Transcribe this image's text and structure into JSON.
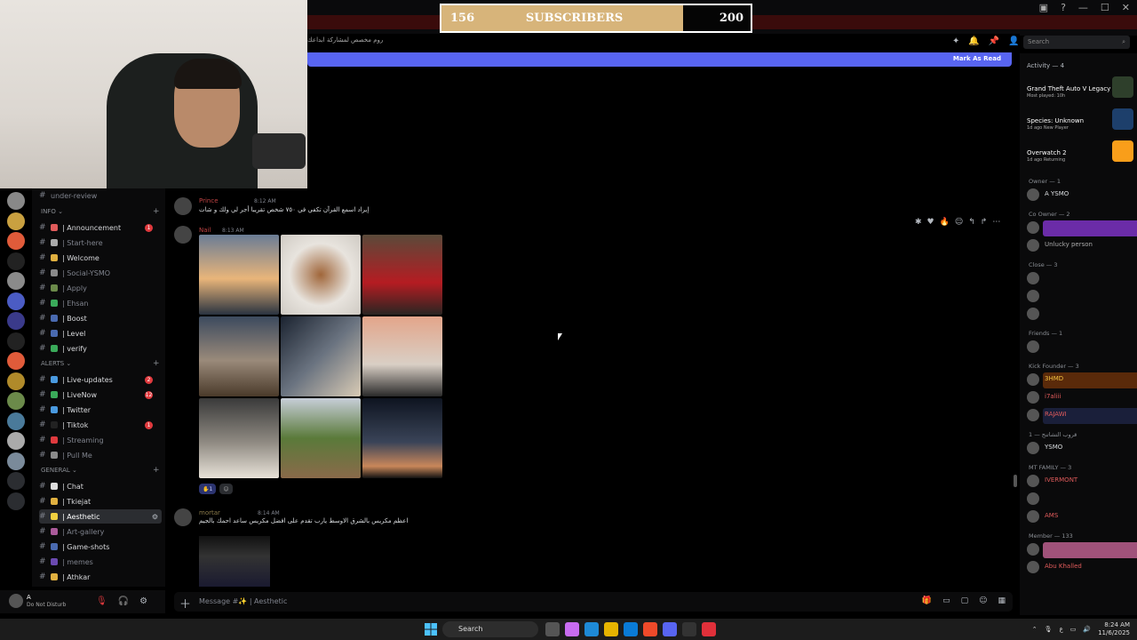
{
  "overlay": {
    "sub_current": "156",
    "sub_label": "SUBSCRIBERS",
    "sub_goal": "200",
    "progress": 0.78
  },
  "header": {
    "channel_topic_rtl": "روم مخصص لمشاركة ابداعك",
    "search_placeholder": "Search",
    "mark_as_read": "Mark As Read"
  },
  "servers": [
    "server-1",
    "server-2",
    "server-3",
    "server-c",
    "server-5",
    "server-6",
    "server-mt",
    "server-8",
    "server-9",
    "server-10",
    "server-11",
    "server-12",
    "server-13",
    "server-14",
    "server-add",
    "server-discover"
  ],
  "sidebar": {
    "top_channel": "under-review",
    "categories": [
      {
        "label": "INFO",
        "channels": [
          {
            "label": "| Announcement",
            "badge": "1",
            "dim": false
          },
          {
            "label": "| Start-here",
            "badge": "",
            "dim": true
          },
          {
            "label": "| Welcome",
            "badge": "",
            "dim": false
          },
          {
            "label": "| Social-YSMO",
            "badge": "",
            "dim": true
          },
          {
            "label": "| Apply",
            "badge": "",
            "dim": true
          },
          {
            "label": "| Ehsan",
            "badge": "",
            "dim": true
          },
          {
            "label": "| Boost",
            "badge": "",
            "dim": false
          },
          {
            "label": "| Level",
            "badge": "",
            "dim": false
          },
          {
            "label": "| verify",
            "badge": "",
            "dim": false
          }
        ]
      },
      {
        "label": "ALERTS",
        "channels": [
          {
            "label": "| Live-updates",
            "badge": "2",
            "dim": false
          },
          {
            "label": "| LiveNow",
            "badge": "12",
            "dim": false
          },
          {
            "label": "| Twitter",
            "badge": "",
            "dim": false
          },
          {
            "label": "| Tiktok",
            "badge": "1",
            "dim": false
          },
          {
            "label": "| Streaming",
            "badge": "",
            "dim": true
          },
          {
            "label": "| Pull Me",
            "badge": "",
            "dim": true
          }
        ]
      },
      {
        "label": "GENERAL",
        "channels": [
          {
            "label": "| Chat",
            "badge": "",
            "dim": false
          },
          {
            "label": "| Tkiejat",
            "badge": "",
            "dim": false
          },
          {
            "label": "| Aesthetic",
            "badge": "",
            "dim": false,
            "active": true
          },
          {
            "label": "| Art-gallery",
            "badge": "",
            "dim": true
          },
          {
            "label": "| Game-shots",
            "badge": "",
            "dim": false
          },
          {
            "label": "| memes",
            "badge": "",
            "dim": true
          },
          {
            "label": "| Athkar",
            "badge": "",
            "dim": false
          }
        ]
      }
    ]
  },
  "user": {
    "name": "A",
    "status": "Do Not Disturb"
  },
  "messages": [
    {
      "author": "Prince",
      "time": "8:12 AM",
      "text": "إيراد اسمع القرآن تكفي في ٧٥٠ شخص تقريبا أجر لي ولك و شات"
    },
    {
      "author": "Nail",
      "time": "8:13 AM",
      "reaction_count": "1"
    },
    {
      "author": "mortar",
      "time": "8:14 AM",
      "text": "اعظم مكريس بالشرق الاوسط يارب تقدم على افضل مكريس ساعد احمك بالجيم"
    }
  ],
  "composer": {
    "placeholder": "Message #✨ | Aesthetic"
  },
  "activity": {
    "title": "Activity — 4",
    "cards": [
      {
        "game": "Grand Theft Auto V Legacy",
        "sub": "Most played: 10h",
        "color": "#2e3f2b"
      },
      {
        "game": "Species: Unknown",
        "sub": "1d ago  New Player",
        "color": "#1d3f6b"
      },
      {
        "game": "Overwatch 2",
        "sub": "1d ago  Returning",
        "color": "#f99e1a"
      }
    ]
  },
  "member_groups": [
    {
      "label": "Owner — 1",
      "members": [
        {
          "name": "A YSMO",
          "color": "#dbdee1",
          "bg": ""
        }
      ]
    },
    {
      "label": "Co Owner — 2",
      "members": [
        {
          "name": "",
          "color": "#dbdee1",
          "bg": "#6b2ca8"
        },
        {
          "name": "Unlucky person",
          "color": "#aaa",
          "bg": ""
        }
      ]
    },
    {
      "label": "Close — 3",
      "members": [
        {
          "name": "",
          "color": "#c24444",
          "bg": ""
        },
        {
          "name": "",
          "color": "#c24444",
          "bg": ""
        },
        {
          "name": "",
          "color": "#c24444",
          "bg": ""
        }
      ]
    },
    {
      "label": "Friends — 1",
      "members": [
        {
          "name": "",
          "color": "#dbdee1",
          "bg": ""
        }
      ]
    },
    {
      "label": "Kick Founder — 3",
      "members": [
        {
          "name": "3HMD",
          "color": "#f0c040",
          "bg": "#5a2a0a"
        },
        {
          "name": "i7aliii",
          "color": "#e05b5b",
          "bg": ""
        },
        {
          "name": "RAJAWI",
          "color": "#e05b5b",
          "bg": "#1a1f3a"
        }
      ]
    },
    {
      "label": "قروب التشاتنج — 1",
      "members": [
        {
          "name": "YSMO",
          "color": "#dbdee1",
          "bg": ""
        }
      ]
    },
    {
      "label": "MT FAMILY — 3",
      "members": [
        {
          "name": "IVERMONT",
          "color": "#e05b5b",
          "bg": ""
        },
        {
          "name": "",
          "color": "#e05b5b",
          "bg": ""
        },
        {
          "name": "AMS",
          "color": "#e05b5b",
          "bg": ""
        }
      ]
    },
    {
      "label": "Member — 133",
      "members": [
        {
          "name": "",
          "color": "#e05b5b",
          "bg": "#a0527a"
        },
        {
          "name": "Abu Khalled",
          "color": "#e05b5b",
          "bg": ""
        }
      ]
    }
  ],
  "taskbar": {
    "search": "Search",
    "time": "8:24 AM",
    "date": "11/6/2025"
  }
}
